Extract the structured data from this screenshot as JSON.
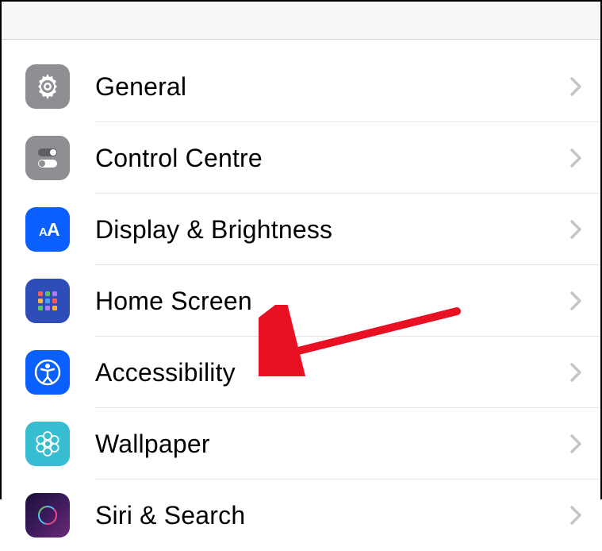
{
  "rows": [
    {
      "id": "general",
      "label": "General"
    },
    {
      "id": "control-centre",
      "label": "Control Centre"
    },
    {
      "id": "display-brightness",
      "label": "Display & Brightness"
    },
    {
      "id": "home-screen",
      "label": "Home Screen"
    },
    {
      "id": "accessibility",
      "label": "Accessibility"
    },
    {
      "id": "wallpaper",
      "label": "Wallpaper"
    },
    {
      "id": "siri-search",
      "label": "Siri & Search"
    }
  ]
}
